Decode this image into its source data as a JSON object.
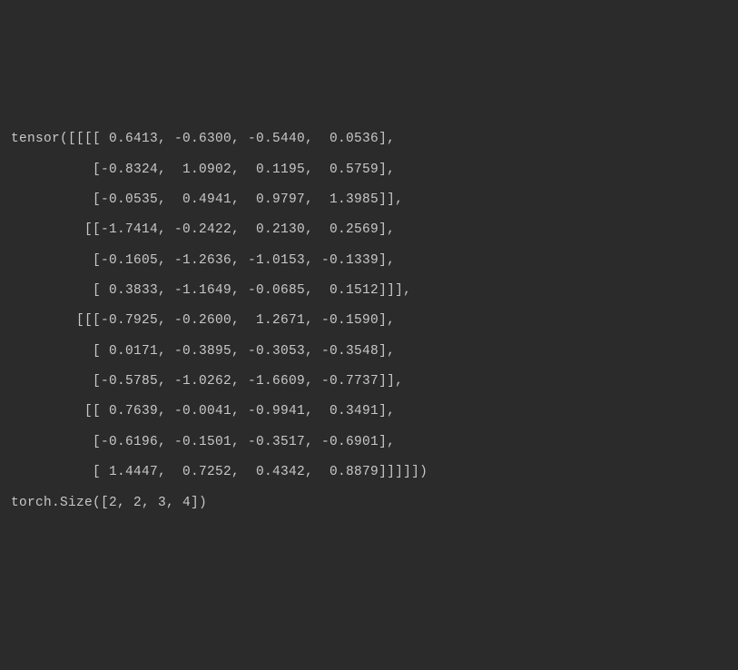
{
  "output": {
    "prefix": "tensor(",
    "tensor": [
      [
        [
          [
            0.6413,
            -0.63,
            -0.544,
            0.0536
          ],
          [
            -0.8324,
            1.0902,
            0.1195,
            0.5759
          ],
          [
            -0.0535,
            0.4941,
            0.9797,
            1.3985
          ]
        ],
        [
          [
            -1.7414,
            -0.2422,
            0.213,
            0.2569
          ],
          [
            -0.1605,
            -1.2636,
            -1.0153,
            -0.1339
          ],
          [
            0.3833,
            -1.1649,
            -0.0685,
            0.1512
          ]
        ]
      ],
      [
        [
          [
            -0.7925,
            -0.26,
            1.2671,
            -0.159
          ],
          [
            0.0171,
            -0.3895,
            -0.3053,
            -0.3548
          ],
          [
            -0.5785,
            -1.0262,
            -1.6609,
            -0.7737
          ]
        ],
        [
          [
            0.7639,
            -0.0041,
            -0.9941,
            0.3491
          ],
          [
            -0.6196,
            -0.1501,
            -0.3517,
            -0.6901
          ],
          [
            1.4447,
            0.7252,
            0.4342,
            0.8879
          ]
        ]
      ]
    ],
    "suffix": ")",
    "size_prefix": "torch.Size(",
    "size": [
      2,
      2,
      3,
      4
    ],
    "size_suffix": ")"
  }
}
